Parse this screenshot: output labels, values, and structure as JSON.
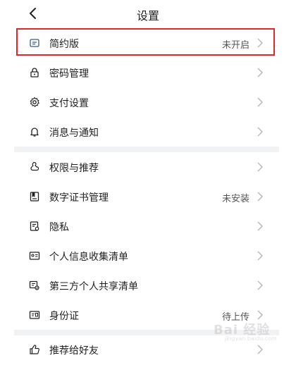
{
  "header": {
    "title": "设置"
  },
  "group1": {
    "items": [
      {
        "label": "简约版",
        "value": "未开启",
        "icon": "simple-mode-icon"
      },
      {
        "label": "密码管理",
        "value": "",
        "icon": "lock-icon"
      },
      {
        "label": "支付设置",
        "value": "",
        "icon": "gear-icon"
      },
      {
        "label": "消息与通知",
        "value": "",
        "icon": "bell-icon"
      }
    ]
  },
  "group2": {
    "items": [
      {
        "label": "权限与推荐",
        "value": "",
        "icon": "permission-icon"
      },
      {
        "label": "数字证书管理",
        "value": "未安装",
        "icon": "certificate-icon"
      },
      {
        "label": "隐私",
        "value": "",
        "icon": "privacy-icon"
      },
      {
        "label": "个人信息收集清单",
        "value": "",
        "icon": "id-card-icon"
      },
      {
        "label": "第三方个人共享清单",
        "value": "",
        "icon": "share-list-icon"
      },
      {
        "label": "身份证",
        "value": "待上传",
        "icon": "identity-card-icon"
      }
    ]
  },
  "group3": {
    "items": [
      {
        "label": "推荐给好友",
        "value": "",
        "icon": "thumbs-up-icon"
      }
    ]
  },
  "watermark": {
    "text": "Bai 经验",
    "sub": "jingyan.baidu.com"
  },
  "colors": {
    "highlight": "#e2262a",
    "separator": "#f1f2f4"
  }
}
